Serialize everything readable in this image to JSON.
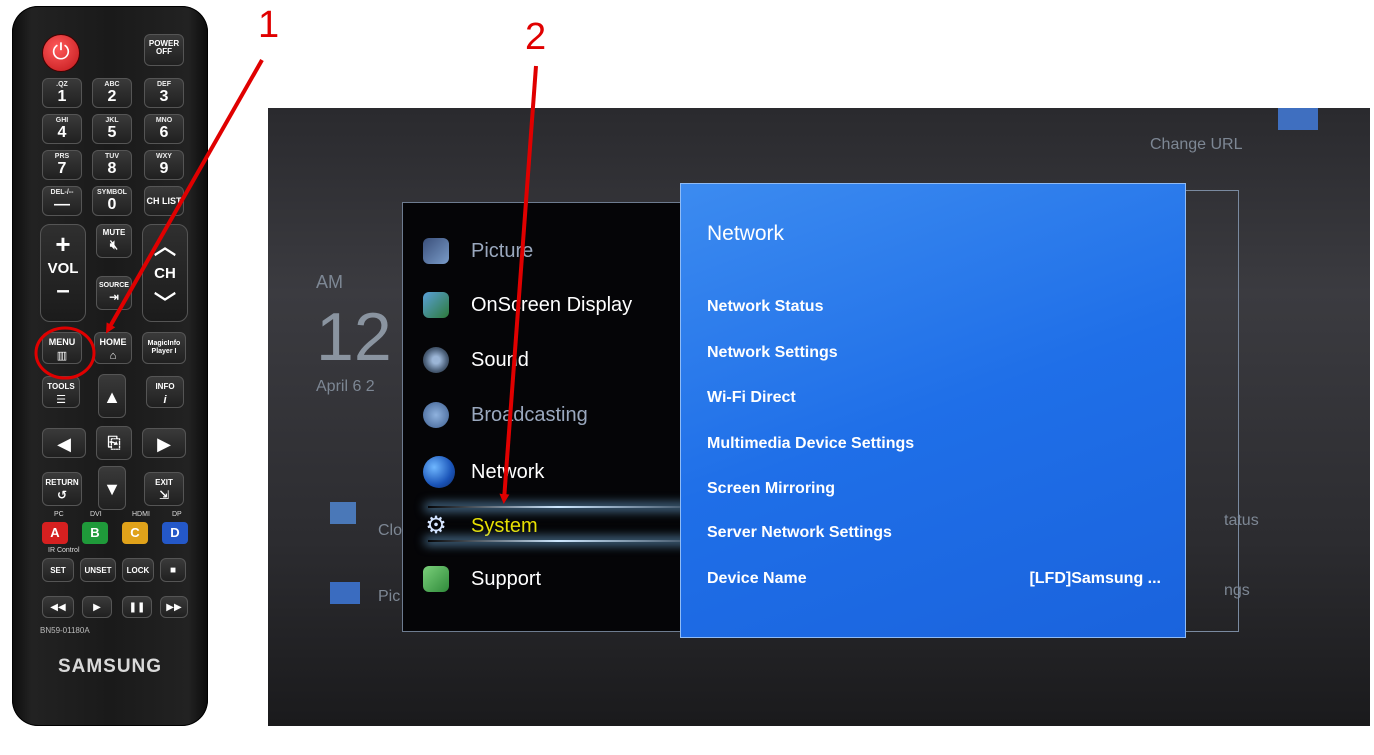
{
  "annotations": {
    "step1": "1",
    "step2": "2"
  },
  "remote": {
    "power_off": "POWER\nOFF",
    "keys": [
      {
        "sub": ".QZ",
        "main": "1"
      },
      {
        "sub": "ABC",
        "main": "2"
      },
      {
        "sub": "DEF",
        "main": "3"
      },
      {
        "sub": "GHI",
        "main": "4"
      },
      {
        "sub": "JKL",
        "main": "5"
      },
      {
        "sub": "MNO",
        "main": "6"
      },
      {
        "sub": "PRS",
        "main": "7"
      },
      {
        "sub": "TUV",
        "main": "8"
      },
      {
        "sub": "WXY",
        "main": "9"
      },
      {
        "sub": "DEL-/--",
        "main": "—"
      },
      {
        "sub": "SYMBOL",
        "main": "0"
      },
      {
        "sub": "",
        "main": "CH LIST"
      }
    ],
    "mute": "MUTE",
    "vol": "VOL",
    "ch": "CH",
    "source": "SOURCE",
    "menu": "MENU",
    "home": "HOME",
    "magicinfo": "MagicInfo Player I",
    "tools": "TOOLS",
    "info": "INFO",
    "return": "RETURN",
    "exit": "EXIT",
    "port_labels": [
      "PC",
      "DVI",
      "HDMI",
      "DP"
    ],
    "color_keys": [
      "A",
      "B",
      "C",
      "D"
    ],
    "ir_control": "IR Control",
    "set": "SET",
    "unset": "UNSET",
    "lock": "LOCK",
    "model": "BN59-01180A",
    "brand": "SAMSUNG"
  },
  "tv": {
    "background": {
      "change_url": "Change URL",
      "am": "AM",
      "clock": "12",
      "date": "April 6 2",
      "tile_left_1": "Clo",
      "tile_left_2": "Pic",
      "tile_right_1": "tatus",
      "tile_right_2": "ngs"
    },
    "menu_items": [
      {
        "label": "Picture",
        "icon": "picture-icon",
        "dim": true
      },
      {
        "label": "OnScreen Display",
        "icon": "onscreen-display-icon",
        "dim": false
      },
      {
        "label": "Sound",
        "icon": "sound-icon",
        "dim": false
      },
      {
        "label": "Broadcasting",
        "icon": "broadcasting-icon",
        "dim": true
      },
      {
        "label": "Network",
        "icon": "globe-icon",
        "dim": false
      },
      {
        "label": "System",
        "icon": "gear-icon",
        "dim": false,
        "selected": true
      },
      {
        "label": "Support",
        "icon": "support-icon",
        "dim": false
      }
    ],
    "submenu": {
      "title": "Network",
      "items": [
        {
          "label": "Network Status"
        },
        {
          "label": "Network Settings"
        },
        {
          "label": "Wi-Fi Direct"
        },
        {
          "label": "Multimedia Device Settings"
        },
        {
          "label": "Screen Mirroring"
        },
        {
          "label": "Server Network Settings"
        },
        {
          "label": "Device Name",
          "value": "[LFD]Samsung ..."
        }
      ]
    },
    "colors": {
      "submenu_bg": "#1f6fe8",
      "selected_text": "#e8e000",
      "annotation": "#e00000"
    }
  }
}
